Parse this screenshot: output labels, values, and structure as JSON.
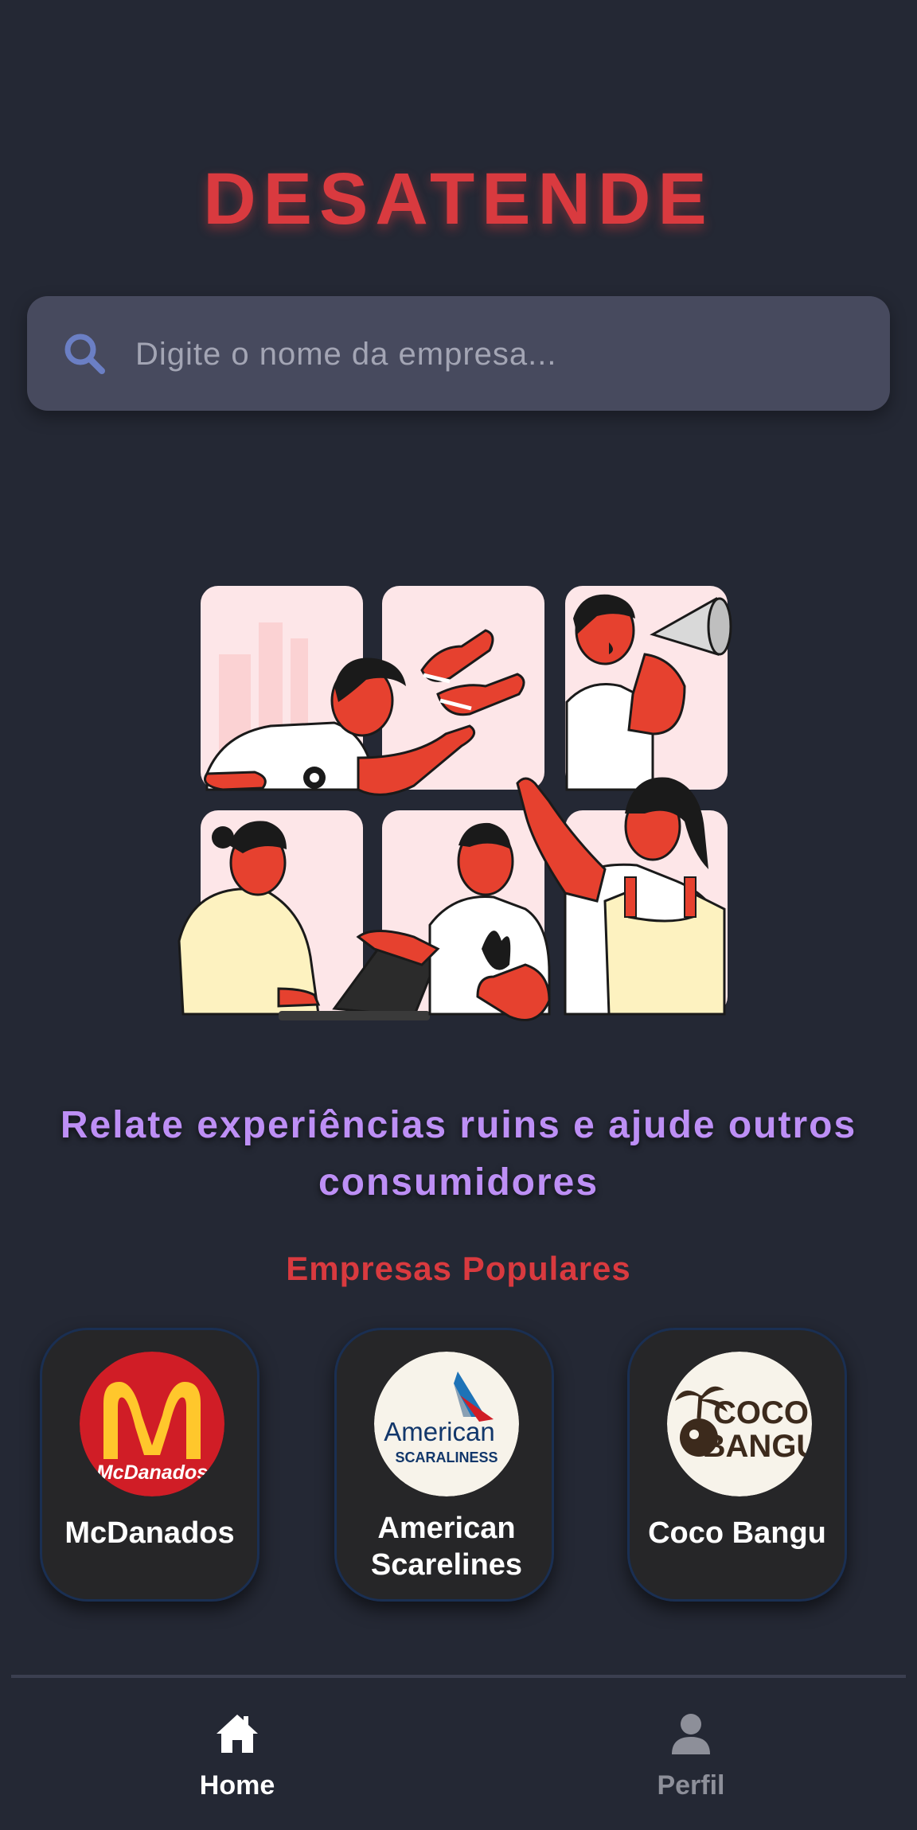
{
  "app": {
    "title": "DESATENDE"
  },
  "search": {
    "placeholder": "Digite o nome da empresa...",
    "icon": "search-icon"
  },
  "hero": {
    "tagline": "Relate experiências ruins e ajude outros consumidores"
  },
  "popular": {
    "title": "Empresas Populares",
    "companies": [
      {
        "name": "McDanados",
        "logo_text": "McDanados",
        "logo_bg": "#d01d26"
      },
      {
        "name": "American Scarelines",
        "logo_text_1": "American",
        "logo_text_2": "SCARALINESS",
        "logo_bg": "#f7f3ea"
      },
      {
        "name": "Coco Bangu",
        "logo_text_1": "COCO",
        "logo_text_2": "BANGU",
        "logo_bg": "#f7f3ea"
      }
    ]
  },
  "nav": {
    "items": [
      {
        "label": "Home",
        "icon": "home-icon",
        "active": true
      },
      {
        "label": "Perfil",
        "icon": "user-icon",
        "active": false
      }
    ]
  },
  "colors": {
    "accent": "#d93a3f",
    "tagline": "#bd8ff5",
    "background": "#242834",
    "search_bg": "#474a5e"
  }
}
